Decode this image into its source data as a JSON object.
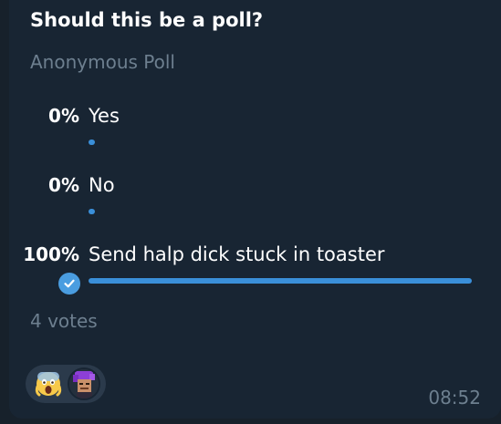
{
  "poll": {
    "question": "Should this be a poll?",
    "type": "Anonymous Poll",
    "options": [
      {
        "percent": "0%",
        "text": "Yes",
        "share": 0,
        "chosen": false
      },
      {
        "percent": "0%",
        "text": "No",
        "share": 0,
        "chosen": false
      },
      {
        "percent": "100%",
        "text": "Send halp dick stuck in toaster",
        "share": 1,
        "chosen": true
      }
    ],
    "votes_label": "4 votes"
  },
  "message": {
    "time": "08:52",
    "reactions": [
      {
        "emoji_icon": "screaming-face-icon",
        "emoji": "😱"
      }
    ]
  },
  "colors": {
    "background": "#17212b",
    "bubble": "#182533",
    "accent": "#3a8fd9",
    "muted_text": "#6d7f8f",
    "text": "#ffffff"
  }
}
